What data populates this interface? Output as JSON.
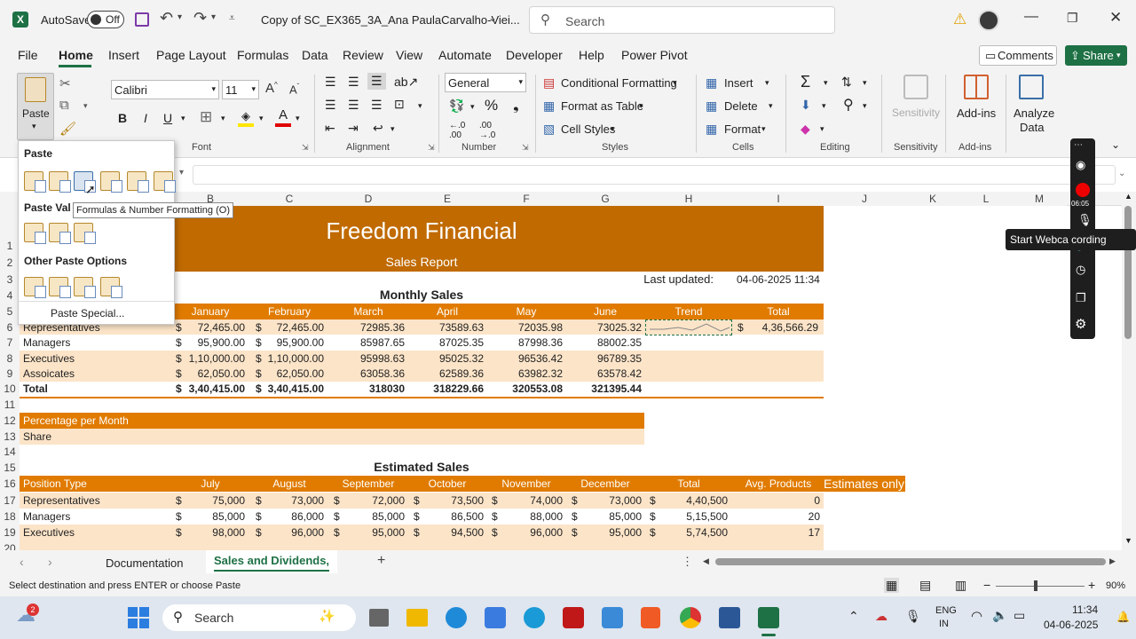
{
  "titlebar": {
    "autosave_label": "AutoSave",
    "autosave_state": "Off",
    "filename": "Copy of SC_EX365_3A_Ana PaulaCarvalho-Viei...",
    "search_placeholder": "Search"
  },
  "menu": [
    "File",
    "Home",
    "Insert",
    "Page Layout",
    "Formulas",
    "Data",
    "Review",
    "View",
    "Automate",
    "Developer",
    "Help",
    "Power Pivot"
  ],
  "menu_active": "Home",
  "header_buttons": {
    "comments": "Comments",
    "share": "Share"
  },
  "ribbon": {
    "paste": "Paste",
    "font_name": "Calibri",
    "font_size": "11",
    "font_group": "Font",
    "alignment_group": "Alignment",
    "number_format": "General",
    "number_group": "Number",
    "conditional_formatting": "Conditional Formatting",
    "format_as_table": "Format as Table",
    "cell_styles": "Cell Styles",
    "styles_group": "Styles",
    "insert": "Insert",
    "delete": "Delete",
    "format": "Format",
    "cells_group": "Cells",
    "editing_group": "Editing",
    "sensitivity": "Sensitivity",
    "sensitivity_group": "Sensitivity",
    "addins": "Add-ins",
    "addins_group": "Add-ins",
    "analyze_data_1": "Analyze",
    "analyze_data_2": "Data"
  },
  "paste_popup": {
    "section1": "Paste",
    "section2": "Paste Val",
    "section3": "Other Paste Options",
    "paste_special": "Paste Special...",
    "tooltip": "Formulas & Number Formatting (O)"
  },
  "recorder": {
    "tooltip": "Start Webca    cording",
    "time": "06:05"
  },
  "columns": [
    "B",
    "C",
    "D",
    "E",
    "F",
    "G",
    "H",
    "I",
    "J",
    "K",
    "L",
    "M"
  ],
  "rows": [
    "1",
    "2",
    "3",
    "4",
    "5",
    "6",
    "7",
    "8",
    "9",
    "10",
    "11",
    "12",
    "13",
    "14",
    "15",
    "16",
    "17",
    "18",
    "19",
    "20"
  ],
  "sheet": {
    "title": "Freedom Financial",
    "subtitle": "Sales Report",
    "last_updated_label": "Last updated:",
    "last_updated_value": "04-06-2025 11:34",
    "monthly_heading": "Monthly Sales",
    "monthly_headers": [
      "January",
      "February",
      "March",
      "April",
      "May",
      "June",
      "Trend",
      "Total"
    ],
    "monthly_rows": [
      {
        "label": "Representatives",
        "c1": "$",
        "jan": "72,465.00",
        "c2": "$",
        "feb": "72,465.00",
        "mar": "72985.36",
        "apr": "73589.63",
        "may": "72035.98",
        "jun": "73025.32",
        "tc": "$",
        "total": "4,36,566.29"
      },
      {
        "label": "Managers",
        "c1": "$",
        "jan": "95,900.00",
        "c2": "$",
        "feb": "95,900.00",
        "mar": "85987.65",
        "apr": "87025.35",
        "may": "87998.36",
        "jun": "88002.35",
        "tc": "",
        "total": ""
      },
      {
        "label": "Executives",
        "c1": "$",
        "jan": "1,10,000.00",
        "c2": "$",
        "feb": "1,10,000.00",
        "mar": "95998.63",
        "apr": "95025.32",
        "may": "96536.42",
        "jun": "96789.35",
        "tc": "",
        "total": ""
      },
      {
        "label": "Assoicates",
        "c1": "$",
        "jan": "62,050.00",
        "c2": "$",
        "feb": "62,050.00",
        "mar": "63058.36",
        "apr": "62589.36",
        "may": "63982.32",
        "jun": "63578.42",
        "tc": "",
        "total": ""
      }
    ],
    "monthly_total": {
      "label": "Total",
      "c1": "$",
      "jan": "3,40,415.00",
      "c2": "$",
      "feb": "3,40,415.00",
      "mar": "318030",
      "apr": "318229.66",
      "may": "320553.08",
      "jun": "321395.44"
    },
    "pct_label": "Percentage per Month",
    "share_label": "Share",
    "estimated_heading": "Estimated Sales",
    "est_headers": [
      "Position Type",
      "July",
      "August",
      "September",
      "October",
      "November",
      "December",
      "Total",
      "Avg. Products"
    ],
    "est_note": "Estimates only",
    "est_rows": [
      {
        "label": "Representatives",
        "jul": "75,000",
        "aug": "73,000",
        "sep": "72,000",
        "oct": "73,500",
        "nov": "74,000",
        "dec": "73,000",
        "total": "4,40,500",
        "avg": "0"
      },
      {
        "label": "Managers",
        "jul": "85,000",
        "aug": "86,000",
        "sep": "85,000",
        "oct": "86,500",
        "nov": "88,000",
        "dec": "85,000",
        "total": "5,15,500",
        "avg": "20"
      },
      {
        "label": "Executives",
        "jul": "98,000",
        "aug": "96,000",
        "sep": "95,000",
        "oct": "94,500",
        "nov": "96,000",
        "dec": "95,000",
        "total": "5,74,500",
        "avg": "17"
      }
    ],
    "currency": "$"
  },
  "tabs": [
    "Documentation",
    "Sales and Dividends,"
  ],
  "active_tab": "Sales and Dividends,",
  "status_text": "Select destination and press ENTER or choose Paste",
  "zoom": "90%",
  "taskbar": {
    "search": "Search",
    "lang1": "ENG",
    "lang2": "IN",
    "time": "11:34",
    "date": "04-06-2025",
    "badge": "2"
  },
  "colors": {
    "orange": "#e07b00",
    "light": "#fce4c8",
    "excel_green": "#1e7145"
  }
}
